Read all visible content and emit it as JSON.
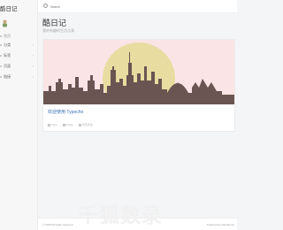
{
  "sidebar": {
    "brand": "酷日记",
    "items": [
      {
        "label": "首页",
        "active": true,
        "chevron": ""
      },
      {
        "label": "分类",
        "active": false,
        "chevron": "›"
      },
      {
        "label": "标签",
        "active": false,
        "chevron": "›"
      },
      {
        "label": "页面",
        "active": false,
        "chevron": "›"
      },
      {
        "label": "链接",
        "active": false,
        "chevron": "›"
      }
    ]
  },
  "topbar": {
    "search_placeholder": "Search"
  },
  "header": {
    "title": "酷日记",
    "description": "我的有趣的生活点滴"
  },
  "post": {
    "title": "欢迎使用 Typecho",
    "meta": {
      "author": "Typo",
      "date": "Friday",
      "comments": "暂无评论"
    }
  },
  "footer": {
    "copyright": "© 2020 All rights reserved",
    "powered": "Powered by Handsome"
  },
  "watermark": "千狐数录",
  "colors": {
    "accent": "#3a6fb5",
    "banner_bg": "#fbe4e6",
    "sun": "#e8dca0",
    "skyline": "#6b5552"
  }
}
